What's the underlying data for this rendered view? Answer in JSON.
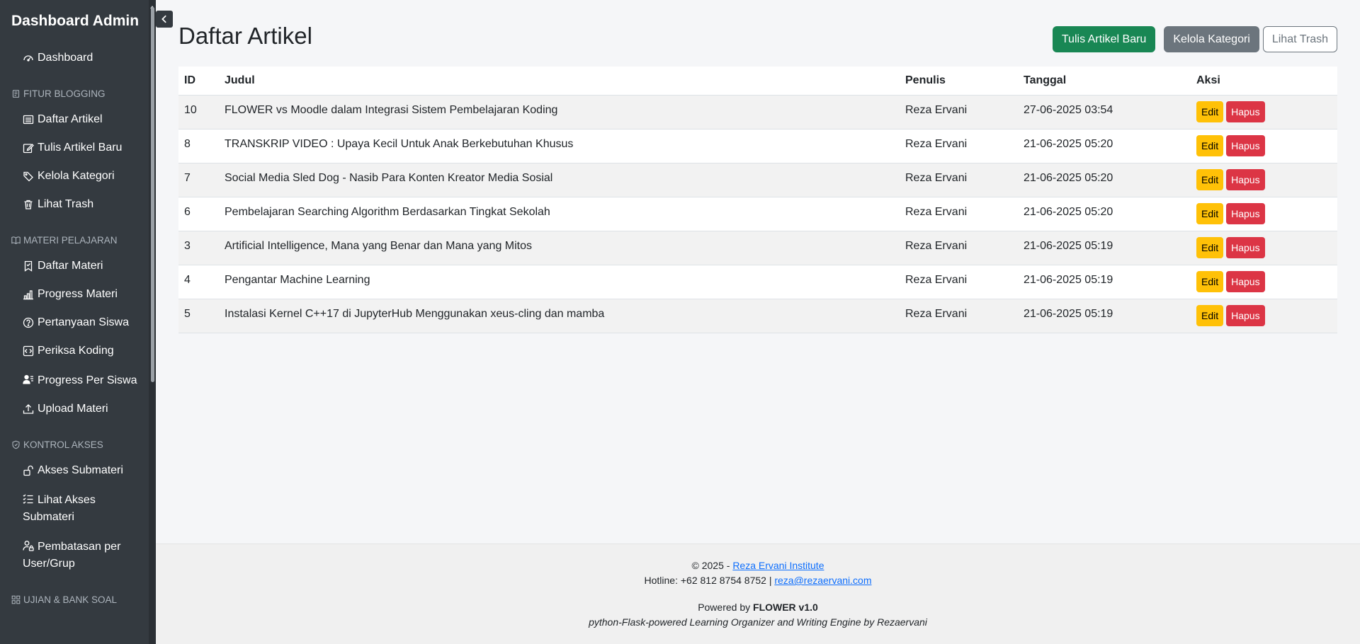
{
  "sidebar": {
    "title": "Dashboard Admin",
    "dashboard_label": "Dashboard",
    "sections": {
      "blogging": "FITUR BLOGGING",
      "materi": "MATERI PELAJARAN",
      "akses": "KONTROL AKSES",
      "ujian": "UJIAN & BANK SOAL"
    },
    "blogging_items": [
      "Daftar Artikel",
      "Tulis Artikel Baru",
      "Kelola Kategori",
      "Lihat Trash"
    ],
    "materi_items": [
      "Daftar Materi",
      "Progress Materi",
      "Pertanyaan Siswa",
      "Periksa Koding",
      "Progress Per Siswa",
      "Upload Materi"
    ],
    "akses_items": [
      "Akses Submateri",
      "Lihat Akses Submateri",
      "Pembatasan per User/Grup"
    ]
  },
  "header": {
    "title": "Daftar Artikel",
    "btn_new": "Tulis Artikel Baru",
    "btn_category": "Kelola Kategori",
    "btn_trash": "Lihat Trash"
  },
  "table": {
    "headers": [
      "ID",
      "Judul",
      "Penulis",
      "Tanggal",
      "Aksi"
    ],
    "edit_label": "Edit",
    "delete_label": "Hapus",
    "rows": [
      {
        "id": "10",
        "judul": "FLOWER vs Moodle dalam Integrasi Sistem Pembelajaran Koding",
        "penulis": "Reza Ervani",
        "tanggal": "27-06-2025 03:54"
      },
      {
        "id": "8",
        "judul": "TRANSKRIP VIDEO : Upaya Kecil Untuk Anak Berkebutuhan Khusus",
        "penulis": "Reza Ervani",
        "tanggal": "21-06-2025 05:20"
      },
      {
        "id": "7",
        "judul": "Social Media Sled Dog - Nasib Para Konten Kreator Media Sosial",
        "penulis": "Reza Ervani",
        "tanggal": "21-06-2025 05:20"
      },
      {
        "id": "6",
        "judul": "Pembelajaran Searching Algorithm Berdasarkan Tingkat Sekolah",
        "penulis": "Reza Ervani",
        "tanggal": "21-06-2025 05:20"
      },
      {
        "id": "3",
        "judul": "Artificial Intelligence, Mana yang Benar dan Mana yang Mitos",
        "penulis": "Reza Ervani",
        "tanggal": "21-06-2025 05:19"
      },
      {
        "id": "4",
        "judul": "Pengantar Machine Learning",
        "penulis": "Reza Ervani",
        "tanggal": "21-06-2025 05:19"
      },
      {
        "id": "5",
        "judul": "Instalasi Kernel C++17 di JupyterHub Menggunakan xeus-cling dan mamba",
        "penulis": "Reza Ervani",
        "tanggal": "21-06-2025 05:19"
      }
    ]
  },
  "footer": {
    "copyright_prefix": "© 2025 - ",
    "institute_link": "Reza Ervani Institute",
    "hotline": "Hotline: +62 812 8754 8752 | ",
    "email": "reza@rezaervani.com",
    "powered_prefix": "Powered by ",
    "product": "FLOWER v1.0",
    "tagline": "python-Flask-powered Learning Organizer and Writing Engine by Rezaervani"
  },
  "icons": {
    "dashboard": "speedometer-icon",
    "list": "list-icon",
    "edit": "pencil-square-icon",
    "tags": "tags-icon",
    "trash": "trash-icon",
    "book": "book-icon",
    "bookmark": "bookmark-icon",
    "chart": "bar-chart-icon",
    "question": "question-circle-icon",
    "code": "code-square-icon",
    "person": "person-lines-icon",
    "upload": "upload-icon",
    "shield": "shield-icon",
    "unlock": "unlock-icon",
    "list-check": "list-check-icon",
    "person-lock": "person-lock-icon",
    "grid": "grid-icon",
    "chevron-left": "chevron-left-icon"
  },
  "colors": {
    "sidebar_bg": "#343a40",
    "success": "#198754",
    "secondary": "#6c757d",
    "warning": "#ffc107",
    "danger": "#dc3545",
    "link": "#0d6efd"
  }
}
